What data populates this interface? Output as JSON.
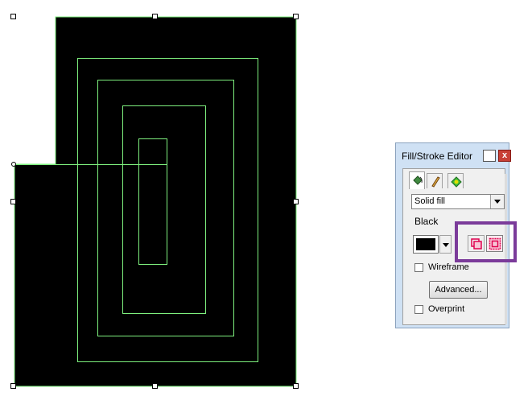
{
  "panel": {
    "title": "Fill/Stroke Editor",
    "close_glyph": "x",
    "tabs": [
      {
        "name": "fill",
        "icon": "paint-bucket-icon",
        "active": true
      },
      {
        "name": "stroke",
        "icon": "pen-icon",
        "active": false
      },
      {
        "name": "effects",
        "icon": "green-diamond-icon",
        "active": false
      }
    ],
    "fill_type": "Solid fill",
    "color_name": "Black",
    "color_value": "#000000",
    "wireframe_label": "Wireframe",
    "wireframe_checked": false,
    "advanced_label": "Advanced...",
    "overprint_label": "Overprint",
    "overprint_checked": false
  },
  "colors": {
    "shape_fill": "#000000",
    "shape_stroke": "#7ef07e",
    "highlight": "#7b3b9a",
    "overprint_icon": "#e0004f"
  }
}
